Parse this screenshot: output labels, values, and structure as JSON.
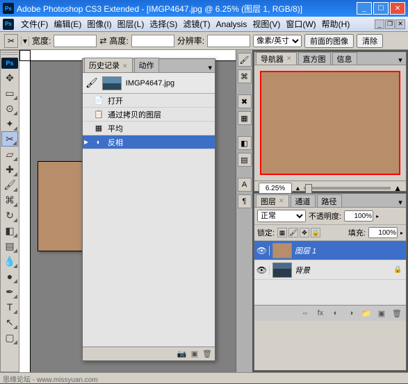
{
  "titlebar": {
    "app": "Adobe Photoshop CS3 Extended",
    "doc": "[IMGP4647.jpg @ 6.25% (图层 1, RGB/8)]"
  },
  "menu": {
    "file": "文件(F)",
    "edit": "编辑(E)",
    "image": "图像(I)",
    "layer": "图层(L)",
    "select": "选择(S)",
    "filter": "滤镜(T)",
    "analysis": "Analysis",
    "view": "视图(V)",
    "window": "窗口(W)",
    "help": "帮助(H)"
  },
  "options": {
    "width_label": "宽度:",
    "height_label": "高度:",
    "res_label": "分辨率:",
    "unit": "像素/英寸",
    "front_image": "前面的图像",
    "clear": "清除",
    "width": "",
    "height": "",
    "res": ""
  },
  "navigator": {
    "tabs": {
      "navigator": "导航器",
      "histogram": "直方图",
      "info": "信息"
    },
    "zoom": "6.25%"
  },
  "layers": {
    "tabs": {
      "layers": "图层",
      "channels": "通道",
      "paths": "路径"
    },
    "blend": "正常",
    "opacity_label": "不透明度:",
    "opacity": "100%",
    "lock_label": "锁定:",
    "fill_label": "填充:",
    "fill": "100%",
    "rows": [
      {
        "name": "图层 1",
        "visible": true,
        "selected": true,
        "thumb": "tan"
      },
      {
        "name": "背景",
        "visible": true,
        "selected": false,
        "thumb": "img",
        "locked": true
      }
    ]
  },
  "history": {
    "tabs": {
      "history": "历史记录",
      "actions": "动作"
    },
    "snapshot": "IMGP4647.jpg",
    "steps": [
      {
        "label": "打开",
        "icon": "📄"
      },
      {
        "label": "通过拷贝的图层",
        "icon": "📋"
      },
      {
        "label": "平均",
        "icon": "▦"
      },
      {
        "label": "反相",
        "icon": "◐",
        "selected": true
      }
    ]
  },
  "footer": "思缘论坛 - www.missyuan.com"
}
